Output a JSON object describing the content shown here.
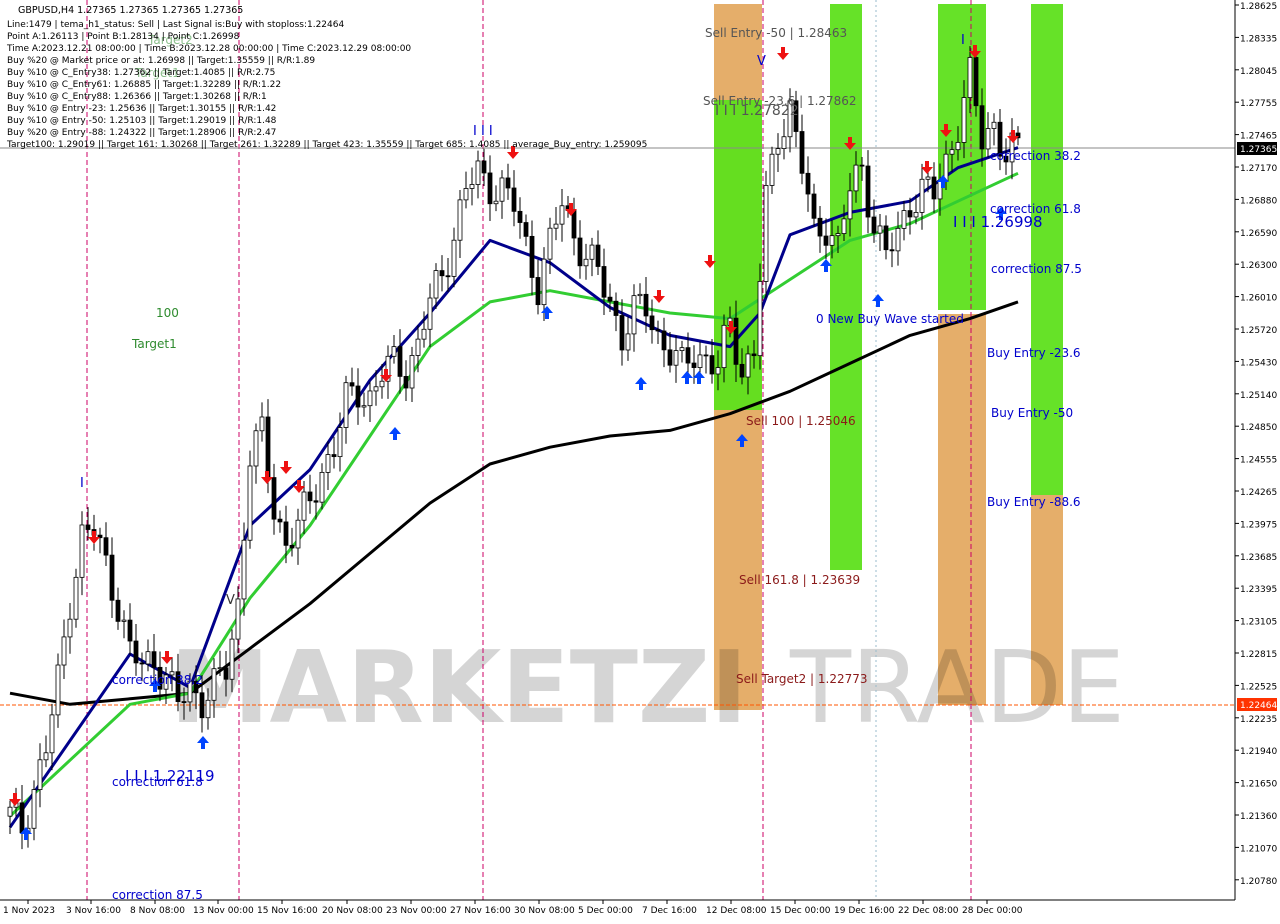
{
  "header": {
    "symbol_line": "GBPUSD,H4  1.27365 1.27365 1.27365 1.27365",
    "info_lines": [
      "Line:1479 | tema_h1_status: Sell | Last Signal is:Buy with stoploss:1.22464",
      "Point A:1.26113 | Point B:1.28134 | Point C:1.26998",
      "Time A:2023.12.21 08:00:00 | Time B:2023.12.28 00:00:00 | Time C:2023.12.29 08:00:00",
      "Buy %20 @ Market price or at: 1.26998 || Target:1.35559 || R/R:1.89",
      "Buy %10 @ C_Entry38: 1.27362 || Target:1.4085 || R/R:2.75",
      "Buy %10 @ C_Entry61: 1.26885 || Target:1.32289 || R/R:1.22",
      "Buy %10 @ C_Entry88: 1.26366 || Target:1.30268 || R/R:1",
      "Buy %10 @ Entry -23: 1.25636 || Target:1.30155 || R/R:1.42",
      "Buy %10 @ Entry -50: 1.25103 || Target:1.29019 || R/R:1.48",
      "Buy %20 @ Entry -88: 1.24322 || Target:1.28906 || R/R:2.47",
      "Target100: 1.29019 || Target 161: 1.30268 || Target 261: 1.32289 || Target 423: 1.35559 || Target 685: 1.4085 || average_Buy_entry: 1.259095"
    ]
  },
  "colors": {
    "background": "#ffffff",
    "bull_candle": "#000000",
    "bear_candle": "#000000",
    "ema_fast": "#00008b",
    "ema_mid": "#32cd32",
    "ema_slow": "#000000",
    "zone_green": "#5ee01c",
    "zone_orange": "#e0a050",
    "vline": "#cc0066",
    "sell_label": "#8b1a1a",
    "buy_label": "#0000cc",
    "target_label": "#2e8b2e",
    "arrow_up": "#0044ff",
    "arrow_down": "#ee1111",
    "price_tag_current": "#000000",
    "price_tag_stop": "#ff3300"
  },
  "watermark": {
    "text_bold": "MARKETZI",
    "text_light": "TRADE"
  },
  "price_axis": {
    "ticks": [
      "1.28625",
      "1.28335",
      "1.28045",
      "1.27755",
      "1.27465",
      "1.27170",
      "1.26880",
      "1.26590",
      "1.26300",
      "1.26010",
      "1.25720",
      "1.25430",
      "1.25140",
      "1.24850",
      "1.24555",
      "1.24265",
      "1.23975",
      "1.23685",
      "1.23395",
      "1.23105",
      "1.22815",
      "1.22525",
      "1.22235",
      "1.21940",
      "1.21650",
      "1.21360",
      "1.21070",
      "1.20780"
    ],
    "current_price": "1.27365",
    "stop_price": "1.22464"
  },
  "time_axis": {
    "labels": [
      "1 Nov 2023",
      "3 Nov 16:00",
      "8 Nov 08:00",
      "13 Nov 00:00",
      "15 Nov 16:00",
      "20 Nov 08:00",
      "23 Nov 00:00",
      "27 Nov 16:00",
      "30 Nov 08:00",
      "5 Dec 00:00",
      "7 Dec 16:00",
      "12 Dec 08:00",
      "15 Dec 00:00",
      "19 Dec 16:00",
      "22 Dec 08:00",
      "28 Dec 00:00"
    ]
  },
  "labels": {
    "sell_entry_50": "Sell Entry -50 | 1.28463",
    "sell_entry_23": "Sell Entry -23.6 | 1.27862",
    "sell_100": "Sell 100 | 1.25046",
    "sell_161": "Sell 161.8 | 1.23639",
    "sell_target2": "Sell Target2 | 1.22773",
    "pattern_a": "I I I 1.27822",
    "pattern_b": "I I I 1.26998",
    "pattern_c": "I I I 1.22119",
    "correction_38_right": "correction 38.2",
    "correction_61_right": "correction 61.8",
    "correction_87_right": "correction 87.5",
    "buy_entry_23": "Buy Entry -23.6",
    "buy_entry_50": "Buy Entry -50",
    "buy_entry_88": "Buy Entry -88.6",
    "new_buy_wave": "0 New Buy Wave started",
    "correction_38_left": "correction 38.2",
    "correction_61_left": "correction 61.8",
    "correction_87_left": "correction 87.5",
    "target_100": "100",
    "target_1": "Target1",
    "target_2": "Target2",
    "target_1_faded": "Target1",
    "triple_bar_top": "I I I",
    "marker_i_a": "I",
    "marker_i_b": "I",
    "marker_v": "V",
    "marker_v2": "V"
  },
  "chart_data": {
    "type": "candlestick",
    "symbol": "GBPUSD",
    "timeframe": "H4",
    "ylim": [
      1.2065,
      1.287
    ],
    "x_dates": [
      "1 Nov 2023",
      "3 Nov 16:00",
      "8 Nov 08:00",
      "13 Nov 00:00",
      "15 Nov 16:00",
      "20 Nov 08:00",
      "23 Nov 00:00",
      "27 Nov 16:00",
      "30 Nov 08:00",
      "5 Dec 00:00",
      "7 Dec 16:00",
      "12 Dec 08:00",
      "15 Dec 00:00",
      "19 Dec 16:00",
      "22 Dec 08:00",
      "28 Dec 00:00"
    ],
    "close_path": [
      [
        0,
        1.214
      ],
      [
        2,
        1.213
      ],
      [
        4,
        1.2165
      ],
      [
        6,
        1.22
      ],
      [
        8,
        1.226
      ],
      [
        10,
        1.2335
      ],
      [
        12,
        1.239
      ],
      [
        14,
        1.2395
      ],
      [
        16,
        1.2365
      ],
      [
        18,
        1.233
      ],
      [
        20,
        1.2285
      ],
      [
        22,
        1.2275
      ],
      [
        24,
        1.228
      ],
      [
        26,
        1.2265
      ],
      [
        28,
        1.224
      ],
      [
        30,
        1.2255
      ],
      [
        32,
        1.2245
      ],
      [
        34,
        1.2255
      ],
      [
        36,
        1.227
      ],
      [
        38,
        1.233
      ],
      [
        40,
        1.2465
      ],
      [
        42,
        1.248
      ],
      [
        44,
        1.2415
      ],
      [
        46,
        1.2385
      ],
      [
        48,
        1.24
      ],
      [
        50,
        1.242
      ],
      [
        52,
        1.245
      ],
      [
        54,
        1.247
      ],
      [
        56,
        1.251
      ],
      [
        58,
        1.252
      ],
      [
        60,
        1.2515
      ],
      [
        62,
        1.2535
      ],
      [
        64,
        1.2545
      ],
      [
        66,
        1.254
      ],
      [
        68,
        1.256
      ],
      [
        70,
        1.26
      ],
      [
        72,
        1.2625
      ],
      [
        74,
        1.266
      ],
      [
        76,
        1.27
      ],
      [
        78,
        1.2715
      ],
      [
        80,
        1.2705
      ],
      [
        82,
        1.27
      ],
      [
        84,
        1.2685
      ],
      [
        86,
        1.265
      ],
      [
        88,
        1.2615
      ],
      [
        90,
        1.265
      ],
      [
        92,
        1.269
      ],
      [
        94,
        1.266
      ],
      [
        96,
        1.264
      ],
      [
        98,
        1.2625
      ],
      [
        100,
        1.26
      ],
      [
        102,
        1.257
      ],
      [
        104,
        1.259
      ],
      [
        106,
        1.2595
      ],
      [
        108,
        1.257
      ],
      [
        110,
        1.2555
      ],
      [
        112,
        1.254
      ],
      [
        114,
        1.2555
      ],
      [
        116,
        1.255
      ],
      [
        118,
        1.254
      ],
      [
        120,
        1.258
      ],
      [
        122,
        1.254
      ],
      [
        124,
        1.2555
      ],
      [
        126,
        1.269
      ],
      [
        128,
        1.275
      ],
      [
        130,
        1.2775
      ],
      [
        132,
        1.272
      ],
      [
        134,
        1.266
      ],
      [
        136,
        1.267
      ],
      [
        138,
        1.265
      ],
      [
        140,
        1.27
      ],
      [
        142,
        1.272
      ],
      [
        144,
        1.267
      ],
      [
        146,
        1.264
      ],
      [
        148,
        1.266
      ],
      [
        150,
        1.269
      ],
      [
        152,
        1.27
      ],
      [
        154,
        1.2695
      ],
      [
        156,
        1.2725
      ],
      [
        158,
        1.276
      ],
      [
        160,
        1.28
      ],
      [
        162,
        1.2745
      ],
      [
        164,
        1.276
      ],
      [
        166,
        1.273
      ],
      [
        168,
        1.2736
      ]
    ],
    "ema_fast": [
      [
        0,
        1.213
      ],
      [
        20,
        1.2285
      ],
      [
        30,
        1.2255
      ],
      [
        40,
        1.24
      ],
      [
        50,
        1.245
      ],
      [
        60,
        1.253
      ],
      [
        70,
        1.259
      ],
      [
        80,
        1.2655
      ],
      [
        90,
        1.2635
      ],
      [
        100,
        1.2595
      ],
      [
        110,
        1.257
      ],
      [
        120,
        1.256
      ],
      [
        125,
        1.259
      ],
      [
        130,
        1.266
      ],
      [
        140,
        1.268
      ],
      [
        150,
        1.269
      ],
      [
        158,
        1.272
      ],
      [
        168,
        1.2738
      ]
    ],
    "ema_mid": [
      [
        0,
        1.214
      ],
      [
        10,
        1.219
      ],
      [
        20,
        1.224
      ],
      [
        30,
        1.225
      ],
      [
        40,
        1.2335
      ],
      [
        50,
        1.24
      ],
      [
        60,
        1.248
      ],
      [
        70,
        1.256
      ],
      [
        80,
        1.26
      ],
      [
        90,
        1.261
      ],
      [
        100,
        1.26
      ],
      [
        110,
        1.259
      ],
      [
        120,
        1.2585
      ],
      [
        130,
        1.262
      ],
      [
        140,
        1.2655
      ],
      [
        150,
        1.267
      ],
      [
        158,
        1.269
      ],
      [
        168,
        1.2715
      ]
    ],
    "ema_slow": [
      [
        0,
        1.225
      ],
      [
        10,
        1.224
      ],
      [
        20,
        1.2245
      ],
      [
        30,
        1.225
      ],
      [
        40,
        1.229
      ],
      [
        50,
        1.233
      ],
      [
        60,
        1.2375
      ],
      [
        70,
        1.242
      ],
      [
        80,
        1.2455
      ],
      [
        90,
        1.247
      ],
      [
        100,
        1.248
      ],
      [
        110,
        1.2485
      ],
      [
        120,
        1.25
      ],
      [
        130,
        1.252
      ],
      [
        140,
        1.2545
      ],
      [
        150,
        1.257
      ],
      [
        160,
        1.2585
      ],
      [
        168,
        1.26
      ]
    ]
  }
}
